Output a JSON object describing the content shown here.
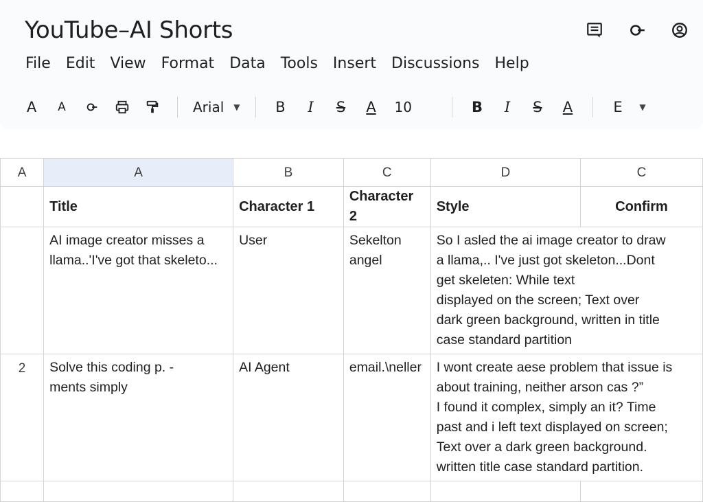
{
  "app": {
    "title": "YouTube–AI Shorts"
  },
  "top_icons": [
    "comment-icon",
    "share-icon",
    "account-icon"
  ],
  "menu": [
    "File",
    "Edit",
    "View",
    "Format",
    "Data",
    "Tools",
    "Insert",
    "Discussions",
    "Help"
  ],
  "toolbar": {
    "left_buttons": [
      "A",
      "A"
    ],
    "font": "Arial",
    "format_a": [
      "B",
      "I",
      "S",
      "A"
    ],
    "font_size": "10",
    "format_b": [
      "B",
      "I",
      "S",
      "A"
    ],
    "last_button": "E"
  },
  "sheet": {
    "corner": "A",
    "column_headers": [
      "A",
      "B",
      "C",
      "D",
      "C"
    ],
    "header_row": [
      "Title",
      "Character 1",
      "Character 2",
      "Style",
      "Confirm"
    ],
    "rows": [
      {
        "row_label": "",
        "cells": [
          "AI image creator misses a\nllama..'I've got that skeleto...",
          "User",
          "Sekelton\nangel",
          "So I asled the ai image creator to draw\na llama,.. I've just got skeleton...Dont\nget skeleten: While text\ndisplayed on the screen; Text over\ndark green background, written in title\ncase standard partition",
          ""
        ]
      },
      {
        "row_label": "2",
        "cells": [
          "Solve this coding p. -\nments simply",
          "AI Agent",
          "email.\\neller",
          "I wont create aese problem that issue is\nabout training, neither arson cas ?”\nI found it complex, simply an it? Time\npast and i left text displayed on screen;\nText over a dark green background.\nwritten title case standard partition.",
          ""
        ]
      },
      {
        "row_label": "",
        "cells": [
          "",
          "",
          "",
          "",
          ""
        ]
      }
    ]
  }
}
